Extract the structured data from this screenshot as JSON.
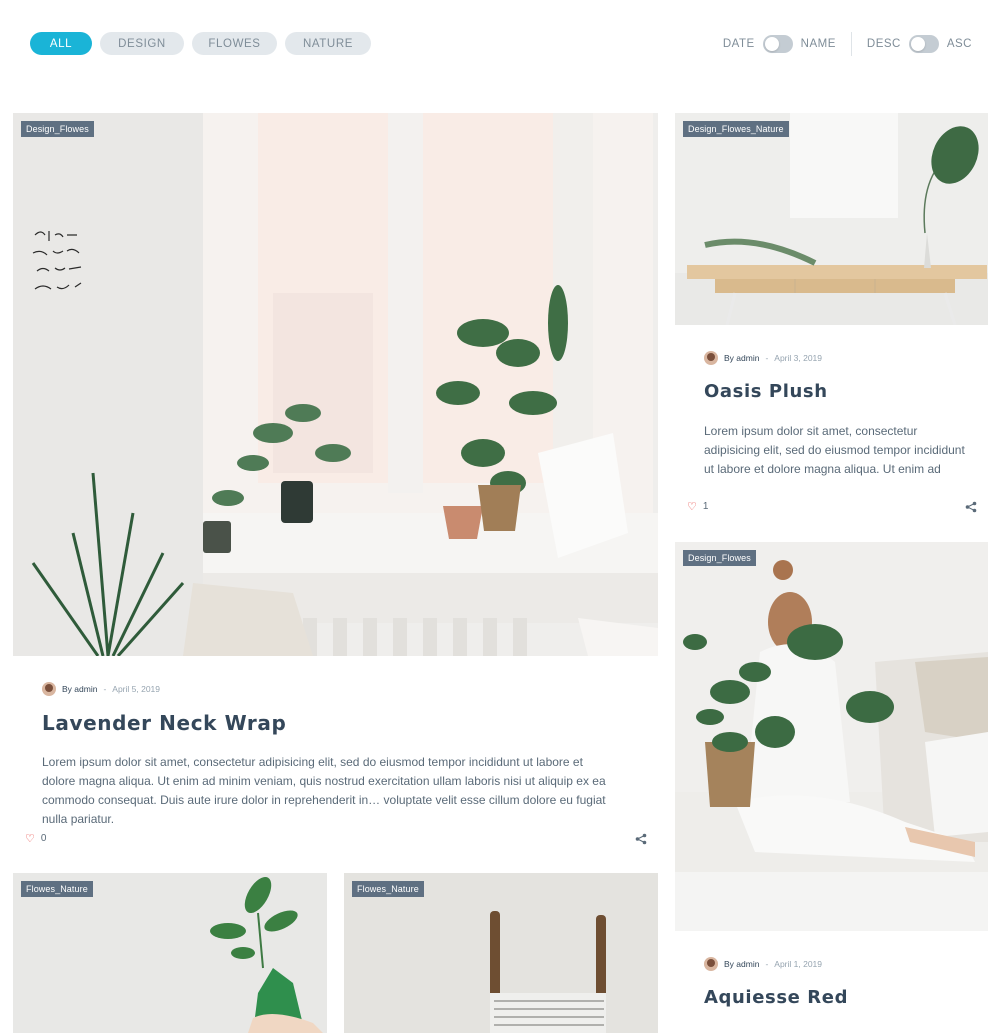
{
  "filters": {
    "tabs": [
      {
        "label": "ALL",
        "active": true
      },
      {
        "label": "DESIGN",
        "active": false
      },
      {
        "label": "FLOWES",
        "active": false
      },
      {
        "label": "NATURE",
        "active": false
      }
    ]
  },
  "sort": {
    "by_left": "DATE",
    "by_right": "NAME",
    "order_left": "DESC",
    "order_right": "ASC"
  },
  "colors": {
    "accent": "#1ab4d7",
    "tag_bg": "#5f7082",
    "heart": "#e53935",
    "heading": "#34475a"
  },
  "posts": [
    {
      "tag": "Design_Flowes",
      "author": "By admin",
      "date": "April 5, 2019",
      "title": "Lavender Neck Wrap",
      "excerpt": "Lorem ipsum dolor sit amet, consectetur adipisicing elit, sed do eiusmod tempor incididunt ut labore et dolore magna aliqua. Ut enim ad minim veniam, quis nostrud exercitation ullam laboris nisi ut aliquip ex ea commodo consequat. Duis aute irure dolor in reprehenderit in… voluptate velit esse cillum dolore eu fugiat nulla pariatur.",
      "likes": "0"
    },
    {
      "tag": "Design_Flowes_Nature",
      "author": "By admin",
      "date": "April 3, 2019",
      "title": "Oasis Plush",
      "excerpt": "Lorem ipsum dolor sit amet, consectetur adipisicing elit, sed do eiusmod tempor incididunt ut labore et dolore magna aliqua. Ut enim ad",
      "likes": "1"
    },
    {
      "tag": "Design_Flowes",
      "author": "By admin",
      "date": "April 1, 2019",
      "title": "Aquiesse Red"
    },
    {
      "tag": "Flowes_Nature"
    },
    {
      "tag": "Flowes_Nature"
    }
  ],
  "meta_separator": "-",
  "icons": {
    "like": "heart-icon",
    "share": "share-icon",
    "author": "avatar"
  }
}
